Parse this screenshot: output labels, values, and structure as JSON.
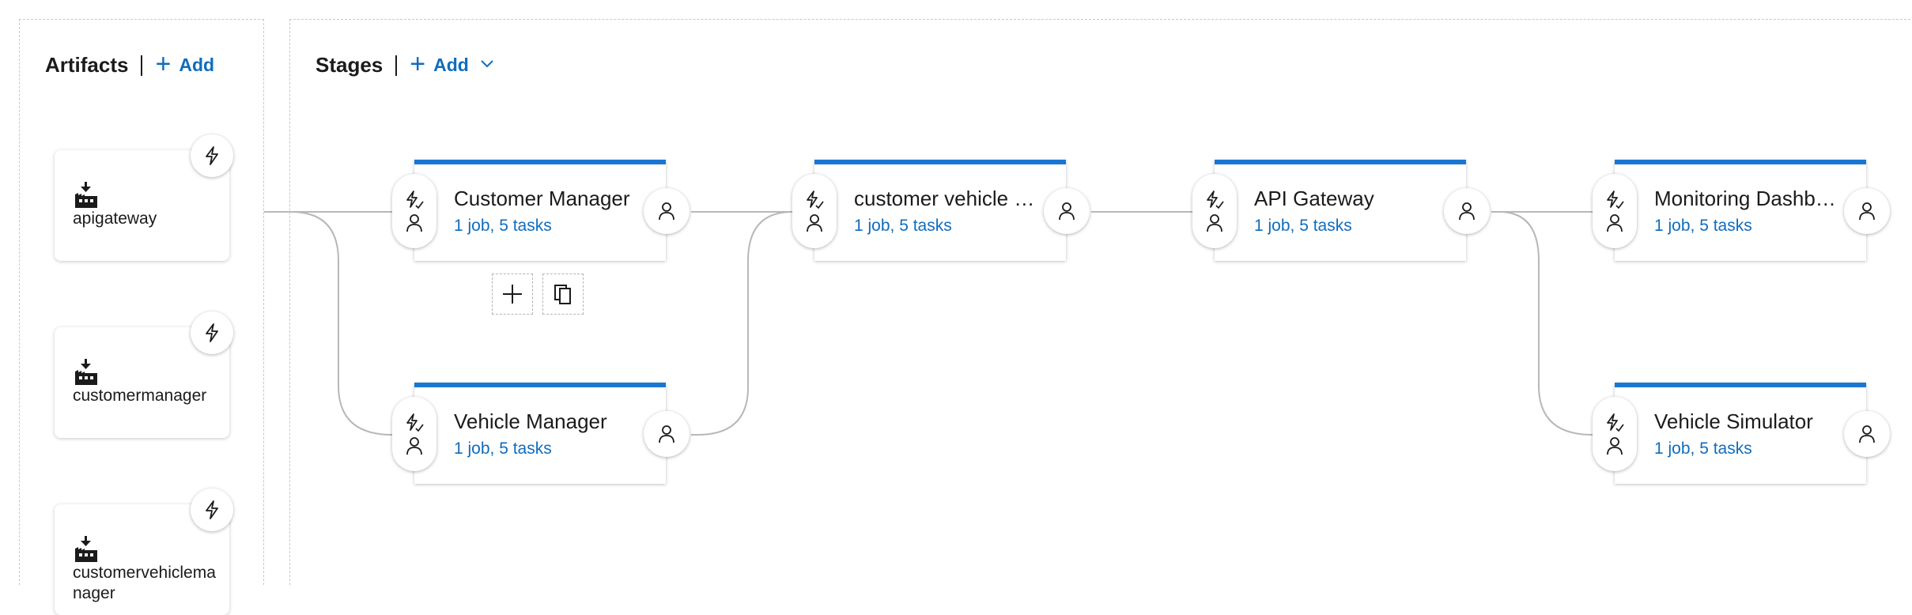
{
  "artifacts": {
    "title": "Artifacts",
    "add_label": "Add",
    "items": [
      {
        "name": "apigateway"
      },
      {
        "name": "customermanager"
      },
      {
        "name": "customervehiclemanager"
      }
    ]
  },
  "stages": {
    "title": "Stages",
    "add_label": "Add",
    "items": [
      {
        "name": "Customer Manager",
        "summary": "1 job, 5 tasks"
      },
      {
        "name": "customer vehicle manager",
        "summary": "1 job, 5 tasks"
      },
      {
        "name": "API Gateway",
        "summary": "1 job, 5 tasks"
      },
      {
        "name": "Monitoring Dashboard",
        "summary": "1 job, 5 tasks"
      },
      {
        "name": "Vehicle Manager",
        "summary": "1 job, 5 tasks"
      },
      {
        "name": "Vehicle Simulator",
        "summary": "1 job, 5 tasks"
      }
    ]
  },
  "stage_actions": {
    "add_icon": "plus-icon",
    "clone_icon": "copy-icon"
  },
  "colors": {
    "accent": "#0f6cbd",
    "stage_top_border": "#1976d2",
    "connector": "#b8b8b8"
  }
}
